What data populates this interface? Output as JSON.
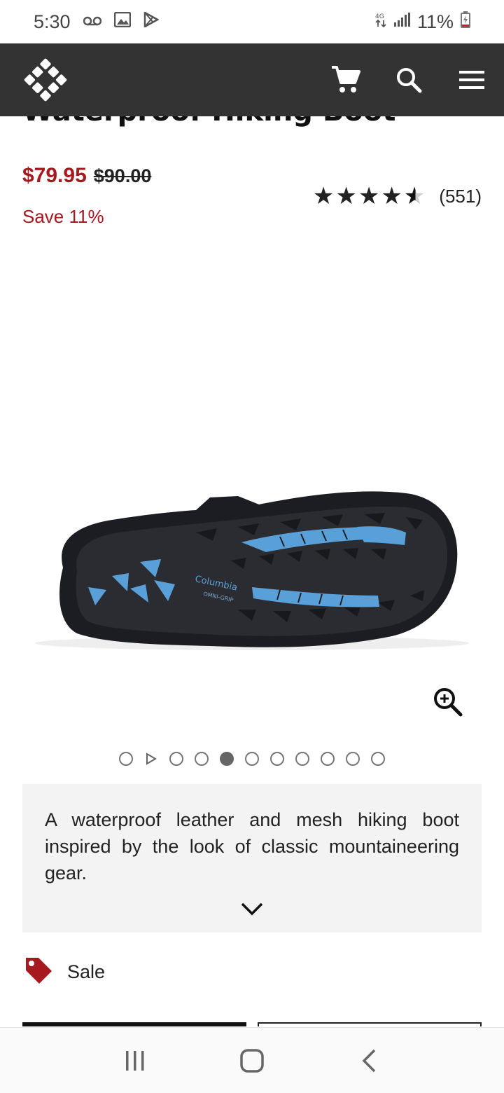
{
  "status_bar": {
    "time": "5:30",
    "battery": "11%",
    "icons": [
      "voicemail-icon",
      "gallery-icon",
      "play-store-icon",
      "data-icon",
      "signal-icon",
      "battery-charging-icon"
    ]
  },
  "nav": {
    "logo": "columbia-logo",
    "icons": [
      "cart-icon",
      "search-icon",
      "menu-icon"
    ],
    "background": "#333333"
  },
  "product": {
    "title": "Waterproof Hiking Boot",
    "sale_price": "$79.95",
    "original_price": "$90.00",
    "savings": "Save 11%",
    "rating": 4.5,
    "rating_max": 5,
    "review_count": "(551)",
    "accent_color": "#a6191f",
    "image_brand_text": "Columbia",
    "image_sole_text": "OMNI-GRIP"
  },
  "carousel": {
    "total_items": 11,
    "active_index": 4,
    "video_index": 1
  },
  "description": {
    "text": "A waterproof leather and mesh hiking boot inspired by the look of classic mountaineering gear."
  },
  "badge": {
    "label": "Sale",
    "icon": "tag-icon"
  },
  "system_nav": {
    "icons": [
      "recents-icon",
      "home-icon",
      "back-icon"
    ]
  }
}
